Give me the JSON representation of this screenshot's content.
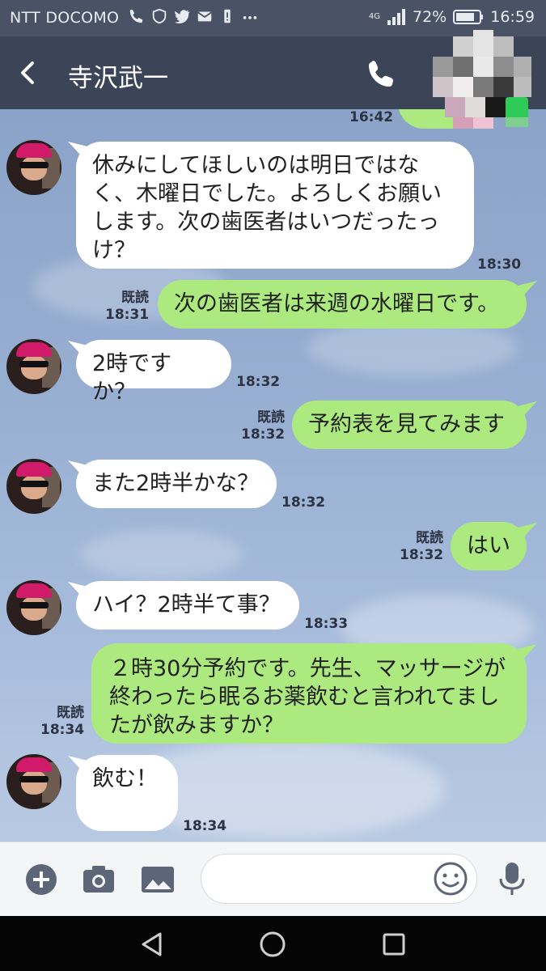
{
  "status_bar": {
    "carrier": "NTT DOCOMO",
    "battery": "72%",
    "clock": "16:59",
    "network": "4G"
  },
  "header": {
    "title": "寺沢武一"
  },
  "messages": [
    {
      "time": "16:42"
    },
    {
      "text": "休みにしてほしいのは明日ではなく、木曜日でした。よろしくお願いします。次の歯医者はいつだったっけ？",
      "time": "18:30"
    },
    {
      "text": "次の歯医者は来週の水曜日です。",
      "read": "既読",
      "time": "18:31"
    },
    {
      "text": "2時ですか？",
      "time": "18:32"
    },
    {
      "text": "予約表を見てみます",
      "read": "既読",
      "time": "18:32"
    },
    {
      "text": "また2時半かな？",
      "time": "18:32"
    },
    {
      "text": "はい",
      "read": "既読",
      "time": "18:32"
    },
    {
      "text": "ハイ？2時半て事？",
      "time": "18:33"
    },
    {
      "text": "２時30分予約です。先生、マッサージが終わったら眠るお薬飲むと言われてましたが飲みますか？",
      "read": "既読",
      "time": "18:34"
    },
    {
      "text": "飲む！",
      "time": "18:34"
    }
  ],
  "input": {
    "placeholder": ""
  },
  "colors": {
    "header": "#3c4558",
    "status_bar": "#4a5366",
    "outgoing_bubble": "#acea7f",
    "incoming_bubble": "#ffffff",
    "chat_background": "#98afd2"
  }
}
